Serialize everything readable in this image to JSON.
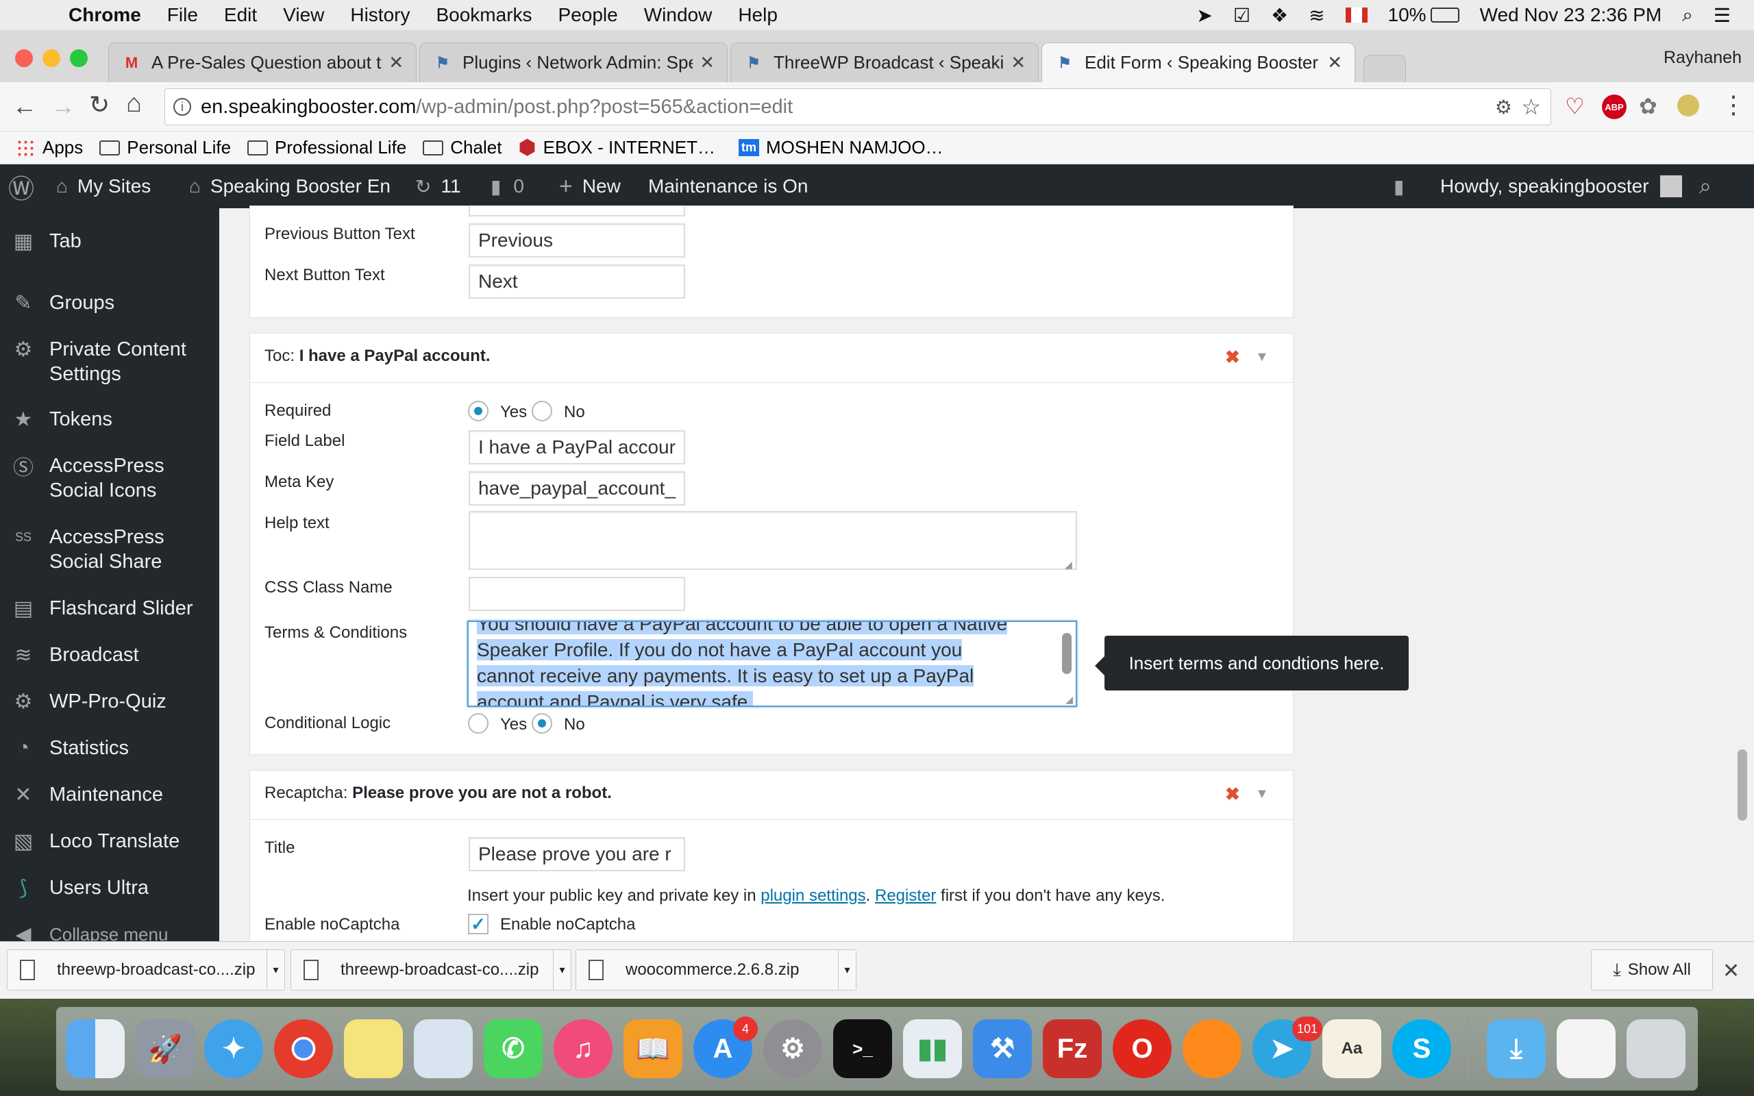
{
  "menubar": {
    "app": "Chrome",
    "items": [
      "File",
      "Edit",
      "View",
      "History",
      "Bookmarks",
      "People",
      "Window",
      "Help"
    ],
    "battery": "10%",
    "datetime": "Wed Nov 23  2:36 PM"
  },
  "tabs": [
    {
      "title": "A Pre-Sales Question about th",
      "icon": "gmail-icon"
    },
    {
      "title": "Plugins ‹ Network Admin: Spea",
      "icon": "wp-site-icon"
    },
    {
      "title": "ThreeWP Broadcast ‹ Speaking",
      "icon": "wp-site-icon"
    },
    {
      "title": "Edit Form ‹ Speaking Booster E",
      "icon": "wp-site-icon"
    }
  ],
  "profile": "Rayhaneh",
  "url": {
    "host": "en.speakingbooster.com",
    "path": "/wp-admin/post.php?post=565&action=edit"
  },
  "bookmarks": [
    "Apps",
    "Personal Life",
    "Professional Life",
    "Chalet",
    "EBOX - INTERNET…",
    "MOSHEN NAMJOO…"
  ],
  "adminbar": {
    "my_sites": "My Sites",
    "site": "Speaking Booster En",
    "updates": "11",
    "comments": "0",
    "new": "New",
    "maintenance": "Maintenance is On",
    "howdy": "Howdy, speakingbooster"
  },
  "sidebar": [
    "Tab",
    "Groups",
    "Private Content Settings",
    "Tokens",
    "AccessPress Social Icons",
    "AccessPress Social Share",
    "Flashcard Slider",
    "Broadcast",
    "WP-Pro-Quiz",
    "Statistics",
    "Maintenance",
    "Loco Translate",
    "Users Ultra",
    "Collapse menu"
  ],
  "form": {
    "prev_label": "Previous Button Text",
    "prev_value": "Previous",
    "next_label": "Next Button Text",
    "next_value": "Next",
    "toc_type": "Toc:",
    "toc_title": "I have a PayPal account.",
    "required_label": "Required",
    "yes": "Yes",
    "no": "No",
    "field_label": "Field Label",
    "field_value": "I have a PayPal accour",
    "meta_label": "Meta Key",
    "meta_value": "have_paypal_account_",
    "help_label": "Help text",
    "css_label": "CSS Class Name",
    "terms_label": "Terms & Conditions",
    "terms_lines": [
      "You should have a PayPal account to be able to open a Native",
      "Speaker Profile. If you do not have a PayPal account you",
      "cannot receive any payments. It is easy to set up a PayPal",
      "account and Paypal is very safe."
    ],
    "tooltip": "Insert terms and condtions here.",
    "cond_label": "Conditional Logic",
    "recap_type": "Recaptcha:",
    "recap_title": "Please prove you are not a robot.",
    "title_label": "Title",
    "title_value": "Please prove you are r",
    "keys_pre": "Insert your public key and private key in ",
    "keys_link1": "plugin settings",
    "keys_mid": ". ",
    "keys_link2": "Register",
    "keys_post": " first if you don't have any keys.",
    "nocaptcha_label": "Enable noCaptcha",
    "nocaptcha_check": "Enable noCaptcha"
  },
  "downloads": [
    "threewp-broadcast-co....zip",
    "threewp-broadcast-co....zip",
    "woocommerce.2.6.8.zip"
  ],
  "show_all": "Show All",
  "dock_badges": {
    "appstore": "4",
    "telegram": "101"
  }
}
